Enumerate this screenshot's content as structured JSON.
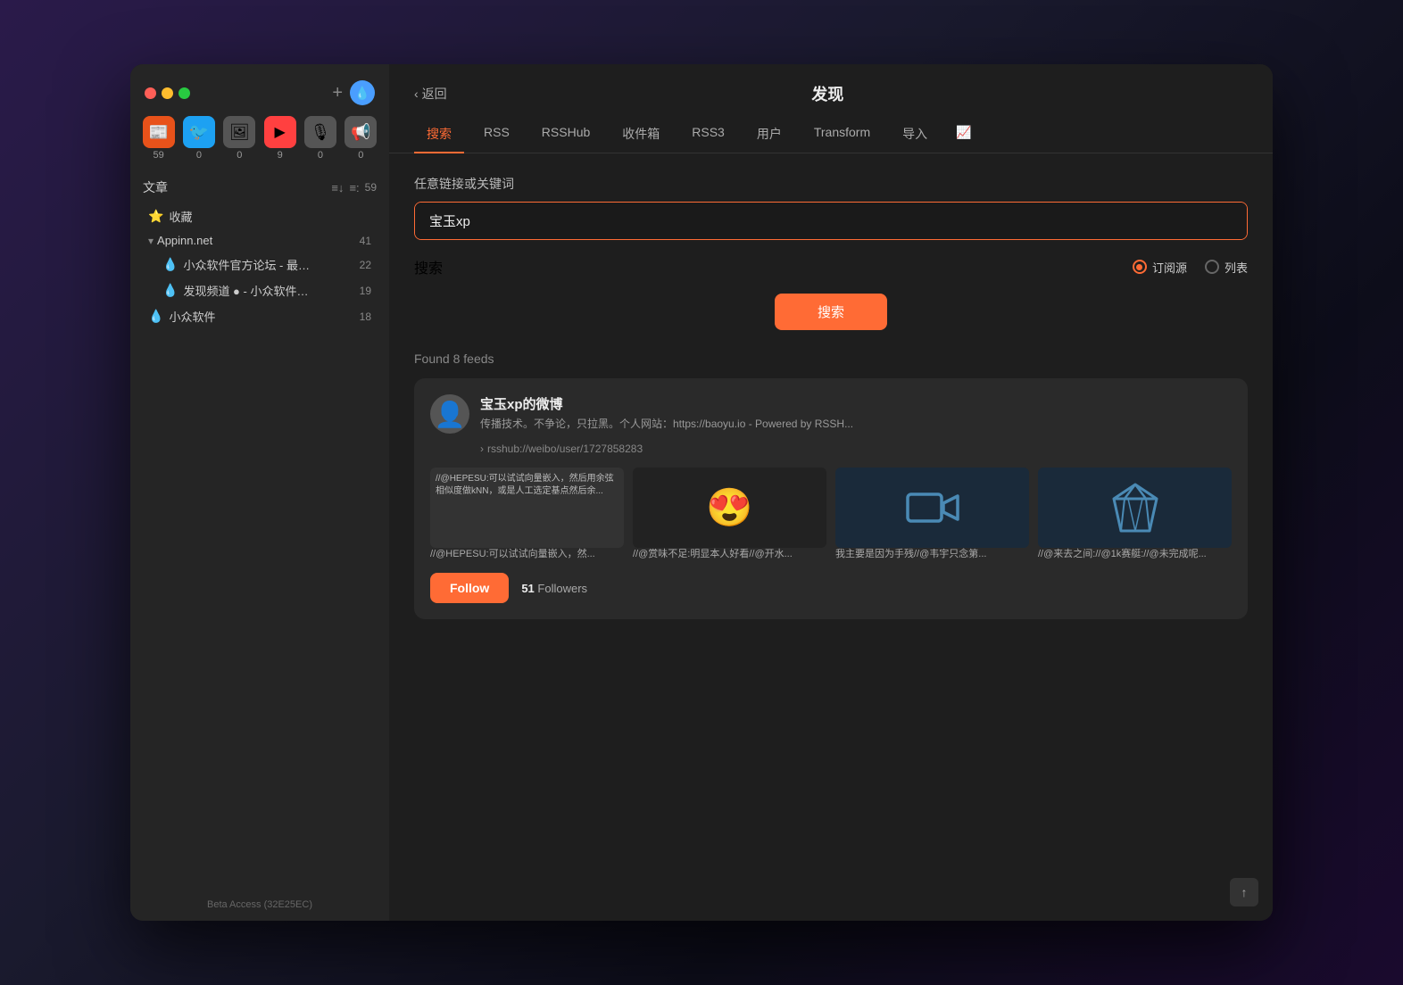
{
  "window": {
    "title": "发现"
  },
  "sidebar": {
    "source_icons": [
      {
        "id": "rss",
        "icon": "📰",
        "badge": "59",
        "color": "icon-orange"
      },
      {
        "id": "twitter",
        "icon": "🐦",
        "badge": "0",
        "color": "icon-blue"
      },
      {
        "id": "image",
        "icon": "🖼",
        "badge": "0",
        "color": "icon-gray"
      },
      {
        "id": "video",
        "icon": "▶",
        "badge": "9",
        "color": "icon-red"
      },
      {
        "id": "mic",
        "icon": "🎙",
        "badge": "0",
        "color": "icon-gray"
      },
      {
        "id": "megaphone",
        "icon": "📢",
        "badge": "0",
        "color": "icon-gray"
      }
    ],
    "articles_label": "文章",
    "article_count": "59",
    "bookmarks_label": "收藏",
    "folder": {
      "label": "Appinn.net",
      "count": "41",
      "items": [
        {
          "label": "小众软件官方论坛 - 最…",
          "count": "22"
        },
        {
          "label": "发现频道 ● - 小众软件…",
          "count": "19"
        }
      ]
    },
    "single_item": {
      "label": "小众软件",
      "count": "18"
    },
    "beta_label": "Beta Access (32E25EC)"
  },
  "main": {
    "back_label": "返回",
    "title": "发现",
    "tabs": [
      {
        "id": "search",
        "label": "搜索",
        "active": true
      },
      {
        "id": "rss",
        "label": "RSS"
      },
      {
        "id": "rsshub",
        "label": "RSSHub"
      },
      {
        "id": "inbox",
        "label": "收件箱"
      },
      {
        "id": "rss3",
        "label": "RSS3"
      },
      {
        "id": "users",
        "label": "用户"
      },
      {
        "id": "transform",
        "label": "Transform"
      },
      {
        "id": "import",
        "label": "导入"
      },
      {
        "id": "trending",
        "label": "📈"
      }
    ],
    "search": {
      "label": "任意链接或关键词",
      "placeholder": "宝玉xp",
      "value": "宝玉xp",
      "options_label": "搜索",
      "radio_options": [
        {
          "id": "subscribe",
          "label": "订阅源",
          "selected": true
        },
        {
          "id": "list",
          "label": "列表",
          "selected": false
        }
      ],
      "search_button_label": "搜索",
      "found_label": "Found 8 feeds"
    },
    "feed_card": {
      "name": "宝玉xp的微博",
      "desc": "传播技术。不争论，只拉黑。个人网站：https://baoyu.io - Powered by RSSH...",
      "url": "rsshub://weibo/user/1727858283",
      "previews": [
        {
          "type": "text",
          "text": "//@HEPESU:可以试试向量嵌入，然后用余弦相似度做kNN，或是人工选定基点然后余...",
          "caption": "//@HEPESU:可以试试向量嵌入，然..."
        },
        {
          "type": "emoji",
          "emoji": "😍",
          "caption": "//@赏味不足:明显本人好看//@开水..."
        },
        {
          "type": "video",
          "caption": "我主要是因为手残//@韦宇只念第..."
        },
        {
          "type": "gem",
          "caption": "//@来去之间://@1k赛艇://@未完成呢..."
        }
      ],
      "follow_label": "Follow",
      "followers_count": "51",
      "followers_label": "Followers"
    }
  }
}
